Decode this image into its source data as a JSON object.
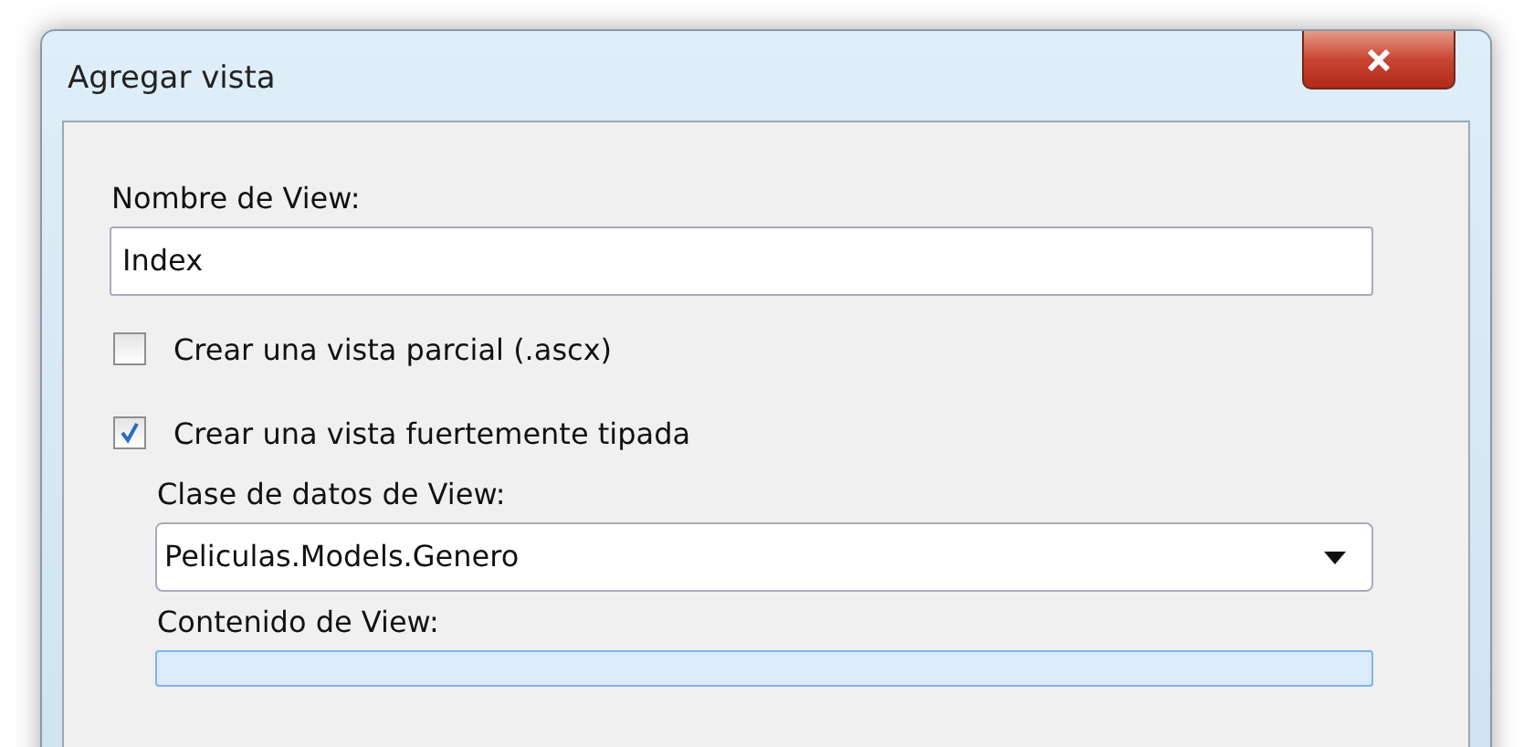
{
  "window": {
    "title": "Agregar vista"
  },
  "view_name": {
    "label": "Nombre de View:",
    "value": "Index"
  },
  "options": [
    {
      "label": "Crear una vista parcial (.ascx)",
      "checked": false
    },
    {
      "label": "Crear una vista fuertemente tipada",
      "checked": true
    }
  ],
  "data_class": {
    "label": "Clase de datos de View:",
    "value": "Peliculas.Models.Genero"
  },
  "view_content": {
    "label": "Contenido de View:"
  }
}
